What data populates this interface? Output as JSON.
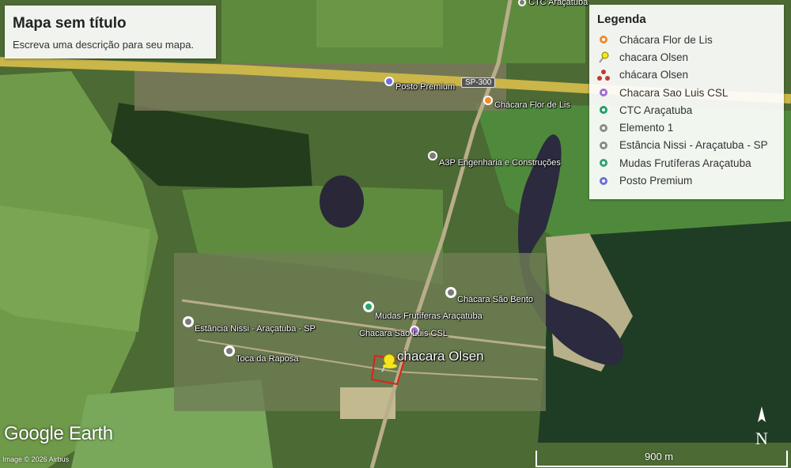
{
  "map": {
    "title": "Mapa sem título",
    "description": "Escreva uma descrição para seu mapa."
  },
  "legend": {
    "heading": "Legenda",
    "items": [
      {
        "label": "Chácara Flor de Lis",
        "icon": "orange-circle-icon",
        "color": "#f08a2c"
      },
      {
        "label": "chacara Olsen",
        "icon": "yellow-pushpin-icon",
        "color": "#f5e51c"
      },
      {
        "label": "chácara Olsen",
        "icon": "red-polygon-icon",
        "color": "#c23a2e"
      },
      {
        "label": "Chacara Sao Luis CSL",
        "icon": "purple-circle-icon",
        "color": "#a36ad8"
      },
      {
        "label": "CTC Araçatuba",
        "icon": "green-circle-icon",
        "color": "#1f9f6a"
      },
      {
        "label": "Elemento 1",
        "icon": "gray-circle-icon",
        "color": "#8a8a8a"
      },
      {
        "label": "Estância Nissi - Araçatuba - SP",
        "icon": "gray-circle-icon",
        "color": "#8a8a8a"
      },
      {
        "label": "Mudas Frutíferas Araçatuba",
        "icon": "green-circle-icon",
        "color": "#2ea36e"
      },
      {
        "label": "Posto Premium",
        "icon": "indigo-circle-icon",
        "color": "#6c6fd8"
      }
    ]
  },
  "places": {
    "ctc": "CTC Araçatuba",
    "posto": "Posto Premium",
    "road": "SP-300",
    "flor": "Chácara Flor de Lis",
    "a3p": "A3P Engenharia e Construções",
    "bento": "Chácara São Bento",
    "mudas": "Mudas Frutíferas Araçatuba",
    "nissi": "Estância Nissi - Araçatuba - SP",
    "saoluis": "Chacara Sao Luis CSL",
    "olsen": "chacara Olsen",
    "toca": "Toca da Raposa"
  },
  "footer": {
    "brand": "Google Earth",
    "attribution": "Image © 2026 Airbus",
    "scale": "900 m",
    "north": "N"
  }
}
